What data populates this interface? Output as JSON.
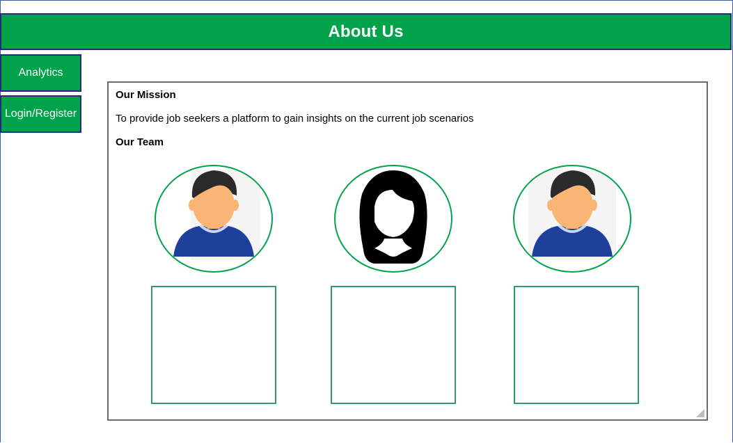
{
  "header": {
    "title": "About Us"
  },
  "nav": {
    "analytics_label": "Analytics",
    "login_label": "Login/Register"
  },
  "content": {
    "mission_heading": "Our Mission",
    "mission_text": "To provide job seekers a platform to gain insights on the current job scenarios",
    "team_heading": "Our Team"
  },
  "team": [
    {
      "avatar_icon": "male-avatar-icon"
    },
    {
      "avatar_icon": "female-avatar-icon"
    },
    {
      "avatar_icon": "male-avatar-icon"
    }
  ],
  "colors": {
    "brand_green": "#00a24a",
    "border_navy": "#1e2f7a",
    "shirt_blue": "#1e3f9a",
    "skin": "#f9b574",
    "hair": "#2a2a2a"
  }
}
